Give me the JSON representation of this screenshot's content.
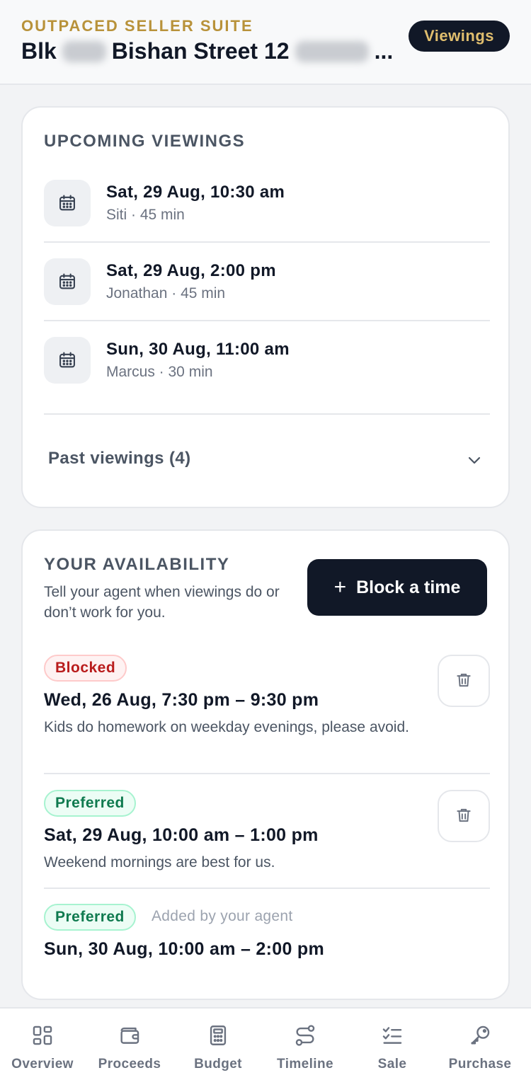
{
  "header": {
    "brand": "OUTPACED SELLER SUITE",
    "address_prefix": "Blk",
    "address_street": "Bishan Street 12",
    "address_ellipsis": "...",
    "viewings_button": "Viewings"
  },
  "upcoming": {
    "title": "UPCOMING VIEWINGS",
    "items": [
      {
        "when": "Sat, 29 Aug, 10:30 am",
        "who": "Siti · 45 min"
      },
      {
        "when": "Sat, 29 Aug, 2:00 pm",
        "who": "Jonathan · 45 min"
      },
      {
        "when": "Sun, 30 Aug, 11:00 am",
        "who": "Marcus · 30 min"
      }
    ],
    "past_label": "Past viewings (4)"
  },
  "availability": {
    "title": "YOUR AVAILABILITY",
    "subtitle": "Tell your agent when viewings do or don’t work for you.",
    "block_button": "Block a time",
    "block_button_icon": "+",
    "slots": [
      {
        "status": "Blocked",
        "when": "Wed, 26 Aug, 7:30 pm – 9:30 pm",
        "note": "Kids do homework on weekday evenings, please avoid."
      },
      {
        "status": "Preferred",
        "when": "Sat, 29 Aug, 10:00 am – 1:00 pm",
        "note": "Weekend mornings are best for us."
      },
      {
        "status": "Preferred",
        "when": "Sun, 30 Aug, 10:00 am – 2:00 pm",
        "added_by": "Added by your agent"
      }
    ]
  },
  "nav": {
    "items": [
      {
        "label": "Overview",
        "icon": "grid-icon"
      },
      {
        "label": "Proceeds",
        "icon": "wallet-icon"
      },
      {
        "label": "Budget",
        "icon": "calculator-icon"
      },
      {
        "label": "Timeline",
        "icon": "route-icon"
      },
      {
        "label": "Sale",
        "icon": "checklist-icon"
      },
      {
        "label": "Purchase",
        "icon": "key-icon"
      }
    ]
  },
  "colors": {
    "brand_gold": "#b8923a",
    "dark": "#111827",
    "blocked_red": "#b91c1c",
    "preferred_green": "#0f7a4f"
  }
}
